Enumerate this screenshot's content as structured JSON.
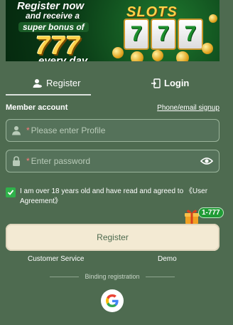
{
  "banner": {
    "line1": "Register now",
    "line2": "and receive a",
    "line3": "super bonus of",
    "line4": "777",
    "line5": "every day.",
    "slots_title": "SLOTS",
    "reels": [
      "7",
      "7",
      "7"
    ]
  },
  "tabs": {
    "register_label": "Register",
    "login_label": "Login"
  },
  "form": {
    "section_label": "Member account",
    "signup_link": "Phone/email signup",
    "profile_required_mark": "*",
    "profile_placeholder": "Please enter Profile",
    "password_required_mark": "*",
    "password_placeholder": "Enter password",
    "agree_text": "I am over 18 years old and have read and agreed to 《User Agreement》",
    "agree_checked": true
  },
  "gift_badge": "1-777",
  "register_button": "Register",
  "links": {
    "customer_service": "Customer Service",
    "demo": "Demo"
  },
  "binding_label": "Binding registration",
  "icons": [
    "register-icon",
    "login-door-icon",
    "user-icon",
    "lock-icon",
    "eye-icon",
    "checkmark-icon",
    "gift-icon",
    "google-icon"
  ],
  "colors": {
    "background": "#4e6b50",
    "button_bg": "#f3ead3",
    "check_green": "#2fb24a",
    "required_red": "#ff7a7a"
  }
}
